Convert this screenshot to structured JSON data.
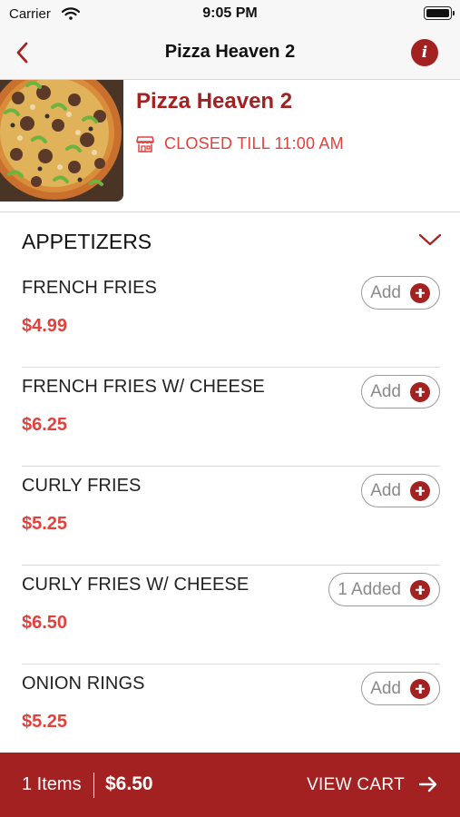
{
  "status_bar": {
    "carrier": "Carrier",
    "time": "9:05 PM"
  },
  "nav": {
    "title": "Pizza Heaven 2",
    "back_icon": "chevron-left-icon",
    "info_icon": "info-icon"
  },
  "restaurant": {
    "name": "Pizza Heaven 2",
    "status": "CLOSED TILL 11:00 AM"
  },
  "section": {
    "title": "APPETIZERS"
  },
  "menu_items": [
    {
      "name": "FRENCH FRIES",
      "price": "$4.99",
      "button_label": "Add"
    },
    {
      "name": "FRENCH FRIES W/ CHEESE",
      "price": "$6.25",
      "button_label": "Add"
    },
    {
      "name": "CURLY FRIES",
      "price": "$5.25",
      "button_label": "Add"
    },
    {
      "name": "CURLY FRIES W/ CHEESE",
      "price": "$6.50",
      "button_label": "1 Added"
    },
    {
      "name": "ONION RINGS",
      "price": "$5.25",
      "button_label": "Add"
    }
  ],
  "cart": {
    "count": "1 Items",
    "total": "$6.50",
    "action": "VIEW CART"
  },
  "colors": {
    "brand": "#a32121",
    "price": "#e2413c",
    "nav_background": "#f7f7f7"
  }
}
